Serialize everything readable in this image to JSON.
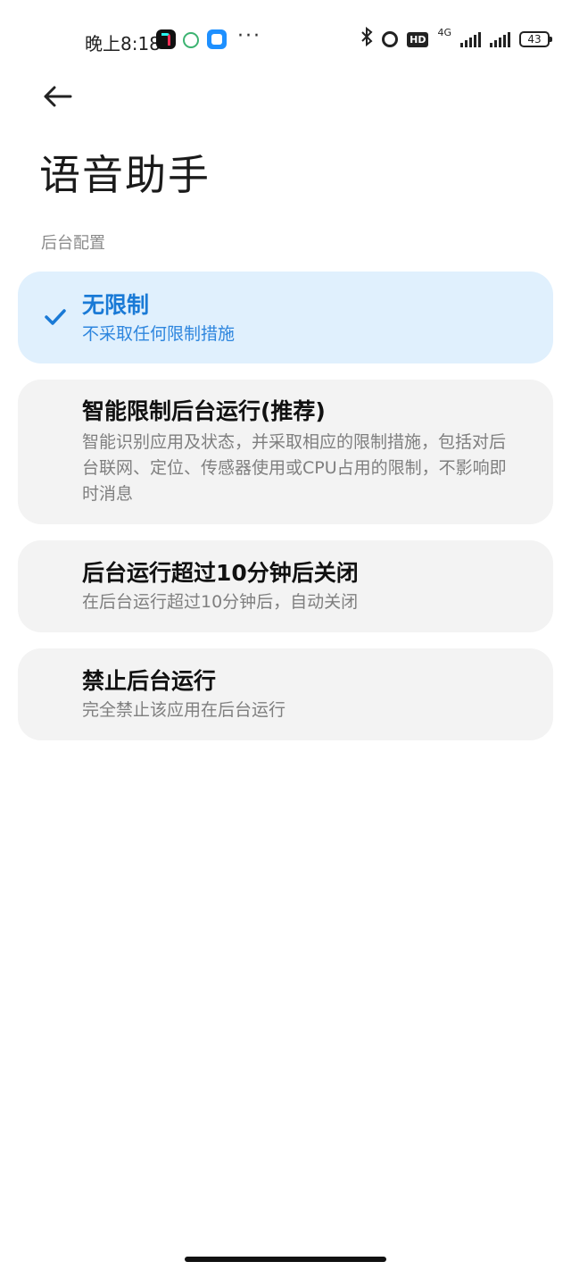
{
  "status_bar": {
    "time": "晚上8:18",
    "more": "···",
    "network": "4G",
    "hd": "HD",
    "battery": "43"
  },
  "header": {
    "title": "语音助手"
  },
  "section": {
    "label": "后台配置"
  },
  "options": [
    {
      "title": "无限制",
      "description": "不采取任何限制措施",
      "selected": true
    },
    {
      "title": "智能限制后台运行(推荐)",
      "description": "智能识别应用及状态，并采取相应的限制措施，包括对后台联网、定位、传感器使用或CPU占用的限制，不影响即时消息",
      "selected": false
    },
    {
      "title": "后台运行超过10分钟后关闭",
      "description": "在后台运行超过10分钟后，自动关闭",
      "selected": false
    },
    {
      "title": "禁止后台运行",
      "description": "完全禁止该应用在后台运行",
      "selected": false
    }
  ],
  "colors": {
    "accent": "#1a7ad6",
    "selected_bg": "#e0f0fd",
    "card_bg": "#f3f3f3"
  },
  "icons": {
    "back": "arrow-left-icon",
    "check": "check-icon"
  }
}
